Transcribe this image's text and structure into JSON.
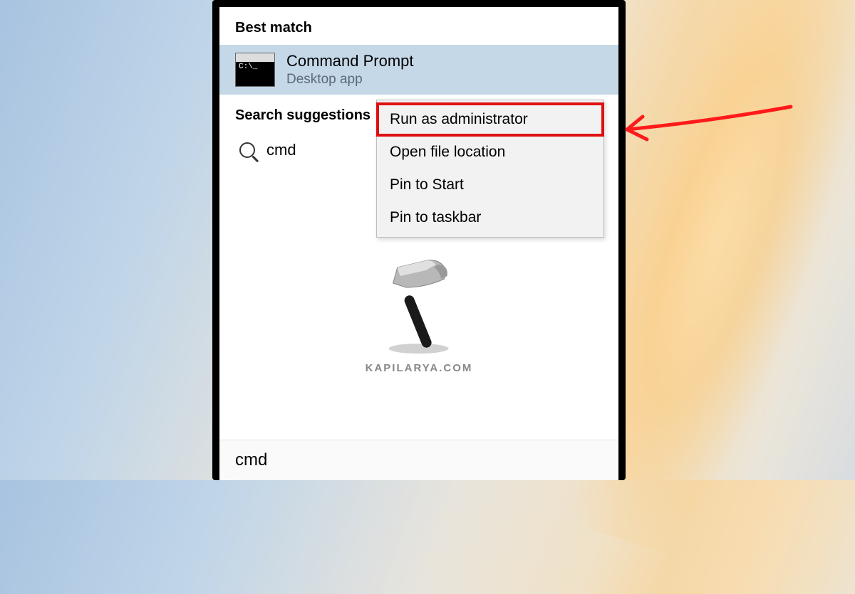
{
  "section_best_match": "Best match",
  "best_match": {
    "title": "Command Prompt",
    "subtitle": "Desktop app",
    "icon_text": "C:\\_"
  },
  "section_suggestions": "Search suggestions",
  "suggestions": [
    {
      "text": "cmd"
    }
  ],
  "context_menu": [
    "Run as administrator",
    "Open file location",
    "Pin to Start",
    "Pin to taskbar"
  ],
  "highlighted_index": 0,
  "search_value": "cmd",
  "watermark": "KAPILARYA.COM"
}
